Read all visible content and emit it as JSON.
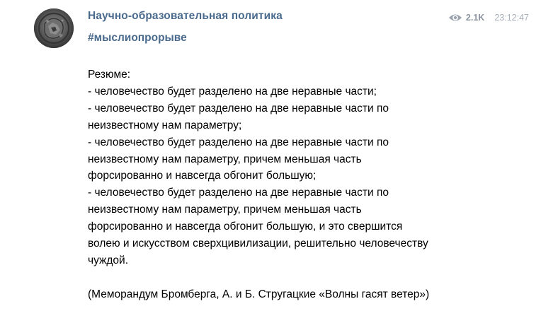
{
  "channel": {
    "name": "Научно-образовательная политика",
    "hashtag": "#мыслиопрорыве"
  },
  "meta": {
    "views": "2.1K",
    "time": "23:12:47",
    "views_icon": "eye-icon"
  },
  "message": {
    "text": "Резюме:\n- человечество будет разделено на две неравные части;\n- человечество будет разделено на две неравные части по\nнеизвестному нам параметру;\n- человечество будет разделено на две неравные части по\nнеизвестному нам параметру, причем меньшая часть\nфорсированно и навсегда обгонит большую;\n- человечество будет разделено на две неравные части по\nнеизвестному нам параметру, причем меньшая часть\nфорсированно и навсегда обгонит большую, и это свершится\nволею и искусством сверхцивилизации, решительно человечеству\nчуждой.\n\n(Меморандум Бромберга, А. и Б. Стругацкие «Волны гасят ветер»)"
  },
  "colors": {
    "name": "#4a6b8e",
    "views": "#8d96a0",
    "time": "#a8b0b9"
  }
}
